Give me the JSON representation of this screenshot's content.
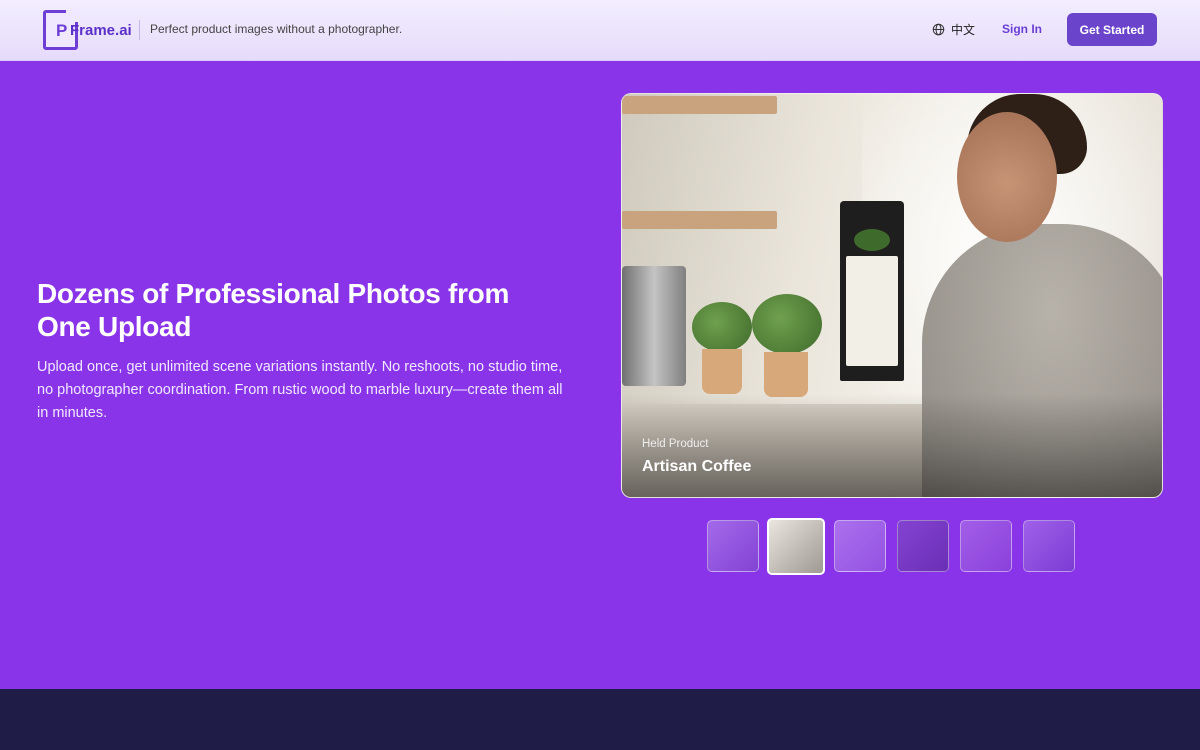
{
  "header": {
    "logo_letter": "P",
    "logo_word": "Frame.ai",
    "tagline": "Perfect product images without a photographer.",
    "language_label": "中文",
    "signin_label": "Sign In",
    "get_started_label": "Get Started"
  },
  "hero": {
    "title": "Dozens of Professional Photos from One Upload",
    "description": "Upload once, get unlimited scene variations instantly. No reshoots, no studio time, no photographer coordination. From rustic wood to marble luxury—create them all in minutes.",
    "showcase": {
      "caption_small": "Held Product",
      "caption_title": "Artisan Coffee"
    },
    "active_thumbnail": 2,
    "thumbnail_count": 6
  },
  "colors": {
    "hero_bg": "#8a34ea",
    "accent": "#6b44cc",
    "bottom_band": "#1f1d48"
  }
}
